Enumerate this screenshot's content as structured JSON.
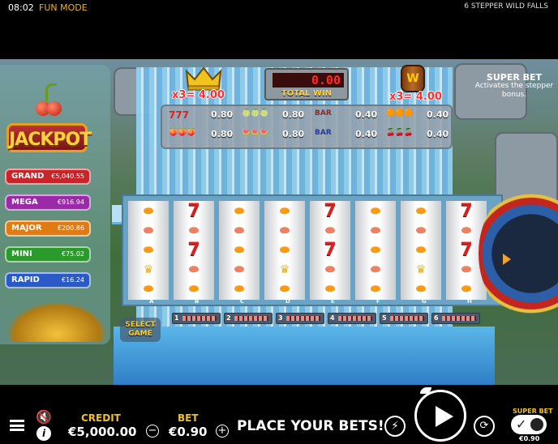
{
  "statusbar": {
    "time": "08:02",
    "mode": "FUN MODE",
    "game_name": "6 STEPPER WILD FALLS"
  },
  "jackpot": {
    "title": "JACKPOT",
    "tiers": [
      {
        "label": "GRAND",
        "value": "€5,040.55",
        "color": "#c8242a"
      },
      {
        "label": "MEGA",
        "value": "€916.94",
        "color": "#9a2aa8"
      },
      {
        "label": "MAJOR",
        "value": "€200.86",
        "color": "#e07a12"
      },
      {
        "label": "MINI",
        "value": "€75.02",
        "color": "#2a9a2a"
      },
      {
        "label": "RAPID",
        "value": "€16.24",
        "color": "#2a5ac8"
      }
    ]
  },
  "top": {
    "crown_mult": "x3= 4.00",
    "barrel_mult": "x3= 4.00",
    "barrel_letter": "W",
    "total_win_value": "0.00",
    "total_win_label": "TOTAL WIN",
    "super_bet_title": "SUPER BET",
    "super_bet_desc": "Activates the stepper bonus."
  },
  "paytable": [
    {
      "symbol": "777",
      "value": "0.80"
    },
    {
      "symbol": "🍈🍈🍈",
      "value": "0.80"
    },
    {
      "symbol": "BAR",
      "value": "0.40"
    },
    {
      "symbol": "🟠🟠🟠",
      "value": "0.40"
    },
    {
      "symbol": "🍑🍑🍑",
      "value": "0.80"
    },
    {
      "symbol": "🍉🍉🍉",
      "value": "0.80"
    },
    {
      "symbol": "BAR",
      "value": "0.40"
    },
    {
      "symbol": "🍒🍒🍒",
      "value": "0.40"
    }
  ],
  "reels": {
    "letters": [
      "A",
      "B",
      "C",
      "D",
      "E",
      "F",
      "G",
      "H"
    ],
    "columns": [
      [
        "orange",
        "peach",
        "orange",
        "crown",
        "orange"
      ],
      [
        "seven",
        "peach",
        "seven",
        "peach",
        "orange"
      ],
      [
        "orange",
        "peach",
        "orange",
        "peach",
        "orange"
      ],
      [
        "orange",
        "peach",
        "orange",
        "crown",
        "orange"
      ],
      [
        "seven",
        "peach",
        "seven",
        "peach",
        "orange"
      ],
      [
        "orange",
        "peach",
        "orange",
        "peach",
        "orange"
      ],
      [
        "orange",
        "peach",
        "orange",
        "crown",
        "orange"
      ],
      [
        "seven",
        "peach",
        "seven",
        "peach",
        "orange"
      ]
    ]
  },
  "select_game": {
    "label": "SELECT GAME",
    "buttons": [
      "1",
      "2",
      "3",
      "4",
      "5",
      "6"
    ]
  },
  "bottom": {
    "credit_label": "CREDIT",
    "credit_value": "€5,000.00",
    "bet_label": "BET",
    "bet_value": "€0.90",
    "message": "PLACE YOUR BETS!",
    "super_bet_label": "SUPER BET",
    "super_bet_value": "€0.90"
  }
}
